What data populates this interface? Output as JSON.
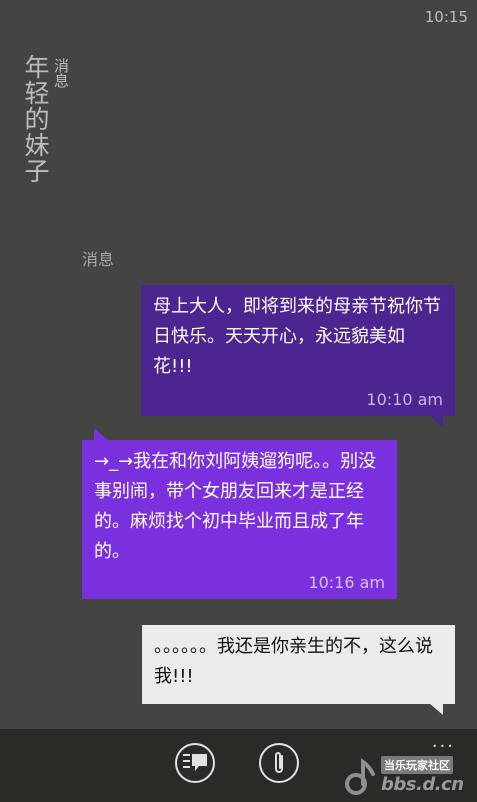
{
  "status_bar": {
    "time": "10:15"
  },
  "contact": {
    "name": "年轻的妹子",
    "subtitle": "消息"
  },
  "thread": {
    "section_label": "消息",
    "messages": [
      {
        "direction": "sent",
        "text": "母上大人，即将到来的母亲节祝你节日快乐。天天开心，永远貌美如花!!!",
        "time": "10:10 am"
      },
      {
        "direction": "received",
        "text": "→_→我在和你刘阿姨遛狗呢。。别没事别闹，带个女朋友回来才是正经的。麻烦找个初中毕业而且成了年的。",
        "time": "10:16 am"
      },
      {
        "direction": "draft",
        "text": "。。。。。。我还是你亲生的不，这么说我!!!",
        "time": ""
      }
    ]
  },
  "app_bar": {
    "buttons": [
      {
        "name": "quick-reply",
        "icon": "speech-bubble-list-icon"
      },
      {
        "name": "attach",
        "icon": "paperclip-icon"
      }
    ],
    "more": "..."
  },
  "watermark": {
    "line1": "当乐玩家社区",
    "line2": "bbs.d.cn"
  },
  "colors": {
    "background": "#444543",
    "sent_bubble": "#4d2590",
    "received_bubble": "#7a30dc",
    "draft_bubble": "#ebebeb",
    "app_bar": "#2a2b27"
  }
}
